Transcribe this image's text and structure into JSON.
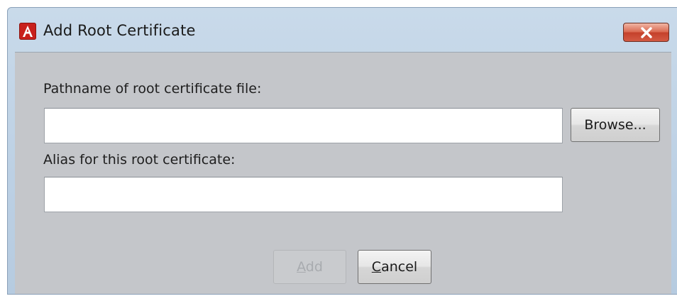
{
  "dialog": {
    "title": "Add Root Certificate",
    "app_icon": "acrobat-icon",
    "close_icon": "close-icon"
  },
  "form": {
    "path_label": "Pathname of root certificate file:",
    "path_value": "",
    "browse_label": "Browse...",
    "alias_label": "Alias for this root certificate:",
    "alias_value": ""
  },
  "buttons": {
    "add": {
      "mnemonic": "A",
      "rest": "dd",
      "enabled": false
    },
    "cancel": {
      "mnemonic": "C",
      "rest": "ancel",
      "enabled": true
    }
  },
  "colors": {
    "title_bar": "#bcd0e4",
    "client_bg": "#c4c6ca",
    "close_button": "#d35a43",
    "app_icon": "#c8201c"
  }
}
